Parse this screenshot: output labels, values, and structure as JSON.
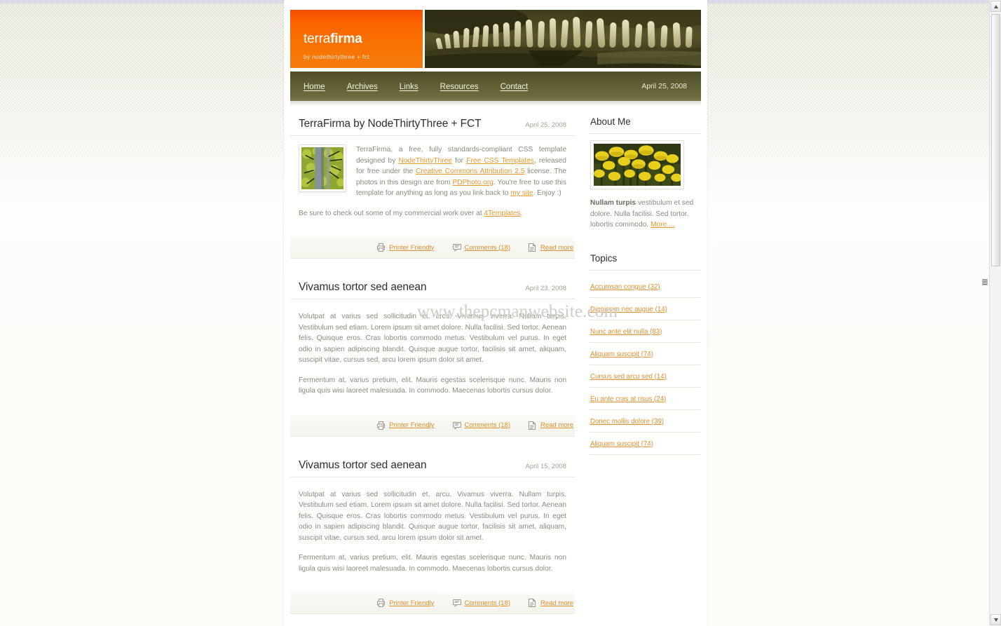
{
  "site": {
    "logo_title_thin": "terra",
    "logo_title_bold": "firma",
    "logo_subtitle": "by nodethirtythree + fct",
    "banner_icon": "fern-photo"
  },
  "nav": {
    "items": [
      {
        "label": "Home",
        "name": "nav-home"
      },
      {
        "label": "Archives",
        "name": "nav-archives"
      },
      {
        "label": "Links",
        "name": "nav-links"
      },
      {
        "label": "Resources",
        "name": "nav-resources"
      },
      {
        "label": "Contact",
        "name": "nav-contact"
      }
    ],
    "date": "April 25, 2008"
  },
  "watermark": "www.thepcmanwebsite.com",
  "posts": [
    {
      "title": "TerraFirma by NodeThirtyThree + FCT",
      "date": "April 25, 2008",
      "thumbnail": "forest-photo",
      "intro_parts": [
        "TerraFirma, a free, fully standards-compliant CSS template designed by ",
        " for ",
        ", released for free under the ",
        " license. The photos in this design are from ",
        ". You're free to use this template for anything as long as you link back to ",
        ". Enjoy :)"
      ],
      "intro_links": [
        "NodeThirtyThree",
        "Free CSS Templates",
        "Creative Commons Attribution 2.5",
        "PDPhoto.org",
        "my site"
      ],
      "second_paragraph_before": "Be sure to check out some of my commercial work over at ",
      "second_paragraph_link": "4Templates",
      "second_paragraph_after": ".",
      "footer": {
        "printer": "Printer Friendly",
        "comments": "Comments (18)",
        "readmore": "Read more"
      }
    },
    {
      "title": "Vivamus tortor sed aenean",
      "date": "April 23, 2008",
      "paragraph1": "Volutpat at varius sed sollicitudin et, arcu. Vivamus viverra. Nullam turpis. Vestibulum sed etiam. Lorem ipsum sit amet dolore. Nulla facilisi. Sed tortor. Aenean felis. Quisque eros. Cras lobortis commodo metus. Vestibulum vel purus. In eget odio in sapien adipiscing blandit. Quisque augue tortor, facilisis sit amet, aliquam, suscipit vitae, cursus sed, arcu lorem ipsum dolor sit amet.",
      "paragraph2": "Fermentum at, varius pretium, elit. Mauris egestas scelerisque nunc. Mauris non ligula quis wisi laoreet malesuada. In commodo. Maecenas lobortis cursus dolor.",
      "footer": {
        "printer": "Printer Friendly",
        "comments": "Comments (18)",
        "readmore": "Read more"
      }
    },
    {
      "title": "Vivamus tortor sed aenean",
      "date": "April 15, 2008",
      "paragraph1": "Volutpat at varius sed sollicitudin et, arcu. Vivamus viverra. Nullam turpis. Vestibulum sed etiam. Lorem ipsum sit amet dolore. Nulla facilisi. Sed tortor. Aenean felis. Quisque eros. Cras lobortis commodo metus. Vestibulum vel purus. In eget odio in sapien adipiscing blandit. Quisque augue tortor, facilisis sit amet, aliquam, suscipit vitae, cursus sed, arcu lorem ipsum dolor sit amet.",
      "paragraph2": "Fermentum at, varius pretium, elit. Mauris egestas scelerisque nunc. Mauris non ligula quis wisi laoreet malesuada. In commodo. Maecenas lobortis cursus dolor.",
      "footer": {
        "printer": "Printer Friendly",
        "comments": "Comments (18)",
        "readmore": "Read more"
      }
    }
  ],
  "sidebar": {
    "about": {
      "heading": "About Me",
      "photo": "yellow-flowers-photo",
      "text_bold": "Nullam turpis",
      "text_rest": " vestibulum et sed dolore. Nulla facilisi. Sed tortor. lobortis commodo. ",
      "more_link": "More ..."
    },
    "topics": {
      "heading": "Topics",
      "items": [
        "Accumsan congue (32)",
        "Dignissim nec augue (14)",
        "Nunc ante elit nulla (83)",
        "Aliquam suscipit (74)",
        "Cursus sed arcu sed (14)",
        "Eu ante cras at risus (24)",
        "Donec mollis dolore (39)",
        "Aliquam suscipit (74)"
      ]
    }
  },
  "colors": {
    "brand_orange": "#f86000",
    "nav_olive": "#5d5c33",
    "link_orange": "#e0912e",
    "body_text": "#8d8a7d",
    "heading": "#2f2f2a"
  }
}
